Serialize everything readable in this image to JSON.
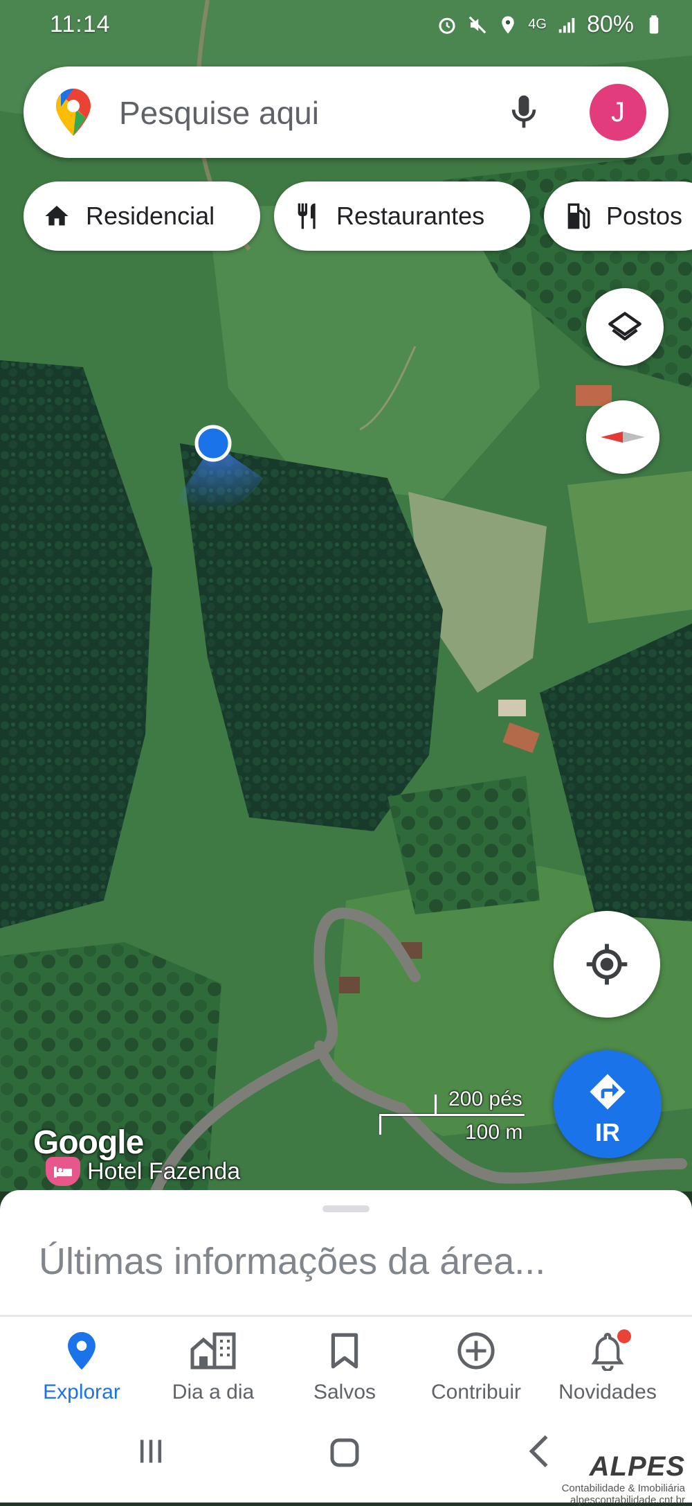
{
  "status_bar": {
    "time": "11:14",
    "battery": "80%",
    "network": "4G"
  },
  "search": {
    "placeholder": "Pesquise aqui",
    "avatar_letter": "J"
  },
  "chips": [
    {
      "label": "Residencial",
      "icon": "home-icon"
    },
    {
      "label": "Restaurantes",
      "icon": "restaurant-icon"
    },
    {
      "label": "Postos",
      "icon": "gas-station-icon"
    }
  ],
  "map": {
    "attribution": "Google",
    "poi_label": "Hotel Fazenda",
    "scale_imperial": "200 pés",
    "scale_metric": "100 m"
  },
  "buttons": {
    "go_label": "IR",
    "layers_icon": "layers-icon",
    "compass_icon": "compass-icon",
    "my_location_icon": "my-location-icon"
  },
  "sheet": {
    "title": "Últimas informações da área..."
  },
  "nav": {
    "items": [
      {
        "label": "Explorar",
        "icon": "explore-pin-icon",
        "active": true
      },
      {
        "label": "Dia a dia",
        "icon": "commute-icon",
        "active": false
      },
      {
        "label": "Salvos",
        "icon": "bookmark-icon",
        "active": false
      },
      {
        "label": "Contribuir",
        "icon": "add-circle-icon",
        "active": false
      },
      {
        "label": "Novidades",
        "icon": "bell-icon",
        "active": false,
        "badge": true
      }
    ]
  },
  "watermark": {
    "name": "ALPES",
    "tagline": "Contabilidade & Imobiliária",
    "url": "alpescontabilidade.cnt.br"
  },
  "colors": {
    "accent": "#1a73e8",
    "avatar": "#e23c7d",
    "badge": "#ea4335"
  }
}
